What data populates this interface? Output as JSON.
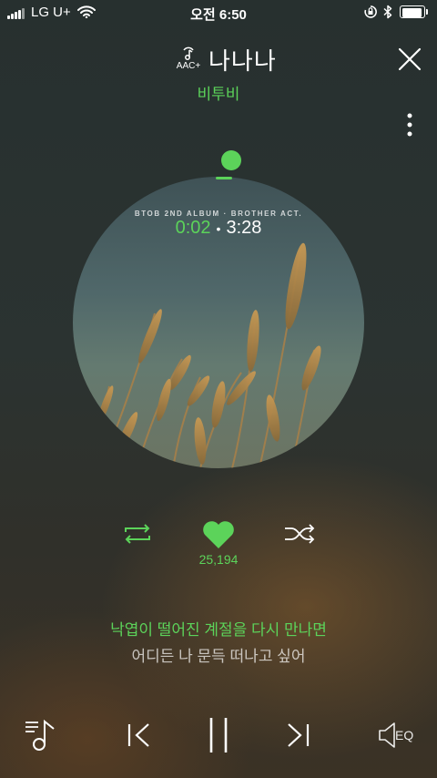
{
  "status_bar": {
    "carrier": "LG U+",
    "time": "오전 6:50",
    "icons": [
      "signal-icon",
      "wifi-icon",
      "orientation-lock-icon",
      "bluetooth-icon",
      "battery-icon"
    ],
    "battery_level": 0.95
  },
  "header": {
    "quality_label": "AAC+",
    "song_title": "나나나",
    "artist": "비투비"
  },
  "album": {
    "album_text": "BTOB 2ND ALBUM · BROTHER ACT.",
    "elapsed": "0:02",
    "separator": "•",
    "duration": "3:28",
    "progress": 0.01
  },
  "actions": {
    "like_count": "25,194"
  },
  "lyrics": {
    "current_line": "낙엽이 떨어진 계절을 다시 만나면",
    "next_line": "어디든 나 문득 떠나고 싶어"
  },
  "controls": {
    "eq_label": "EQ"
  },
  "colors": {
    "accent": "#5cd35a",
    "text": "#ffffff"
  }
}
